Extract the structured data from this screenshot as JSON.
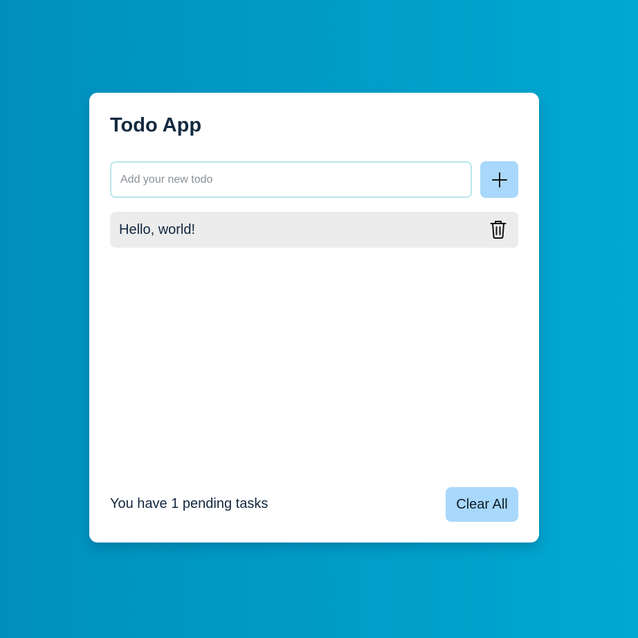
{
  "app": {
    "title": "Todo App"
  },
  "input": {
    "value": "",
    "placeholder": "Add your new todo"
  },
  "add_button": {
    "icon": "plus-icon"
  },
  "todos": [
    {
      "text": "Hello, world!",
      "delete_icon": "trash-icon"
    }
  ],
  "footer": {
    "pending_count": 1,
    "pending_text": "You have 1 pending tasks",
    "clear_label": "Clear All"
  },
  "colors": {
    "background_start": "#0090bd",
    "background_end": "#00a8d2",
    "card": "#ffffff",
    "accent_button": "#a8d8fb",
    "todo_item": "#ececec",
    "input_border": "#b8e6ec",
    "text": "#10263d"
  }
}
